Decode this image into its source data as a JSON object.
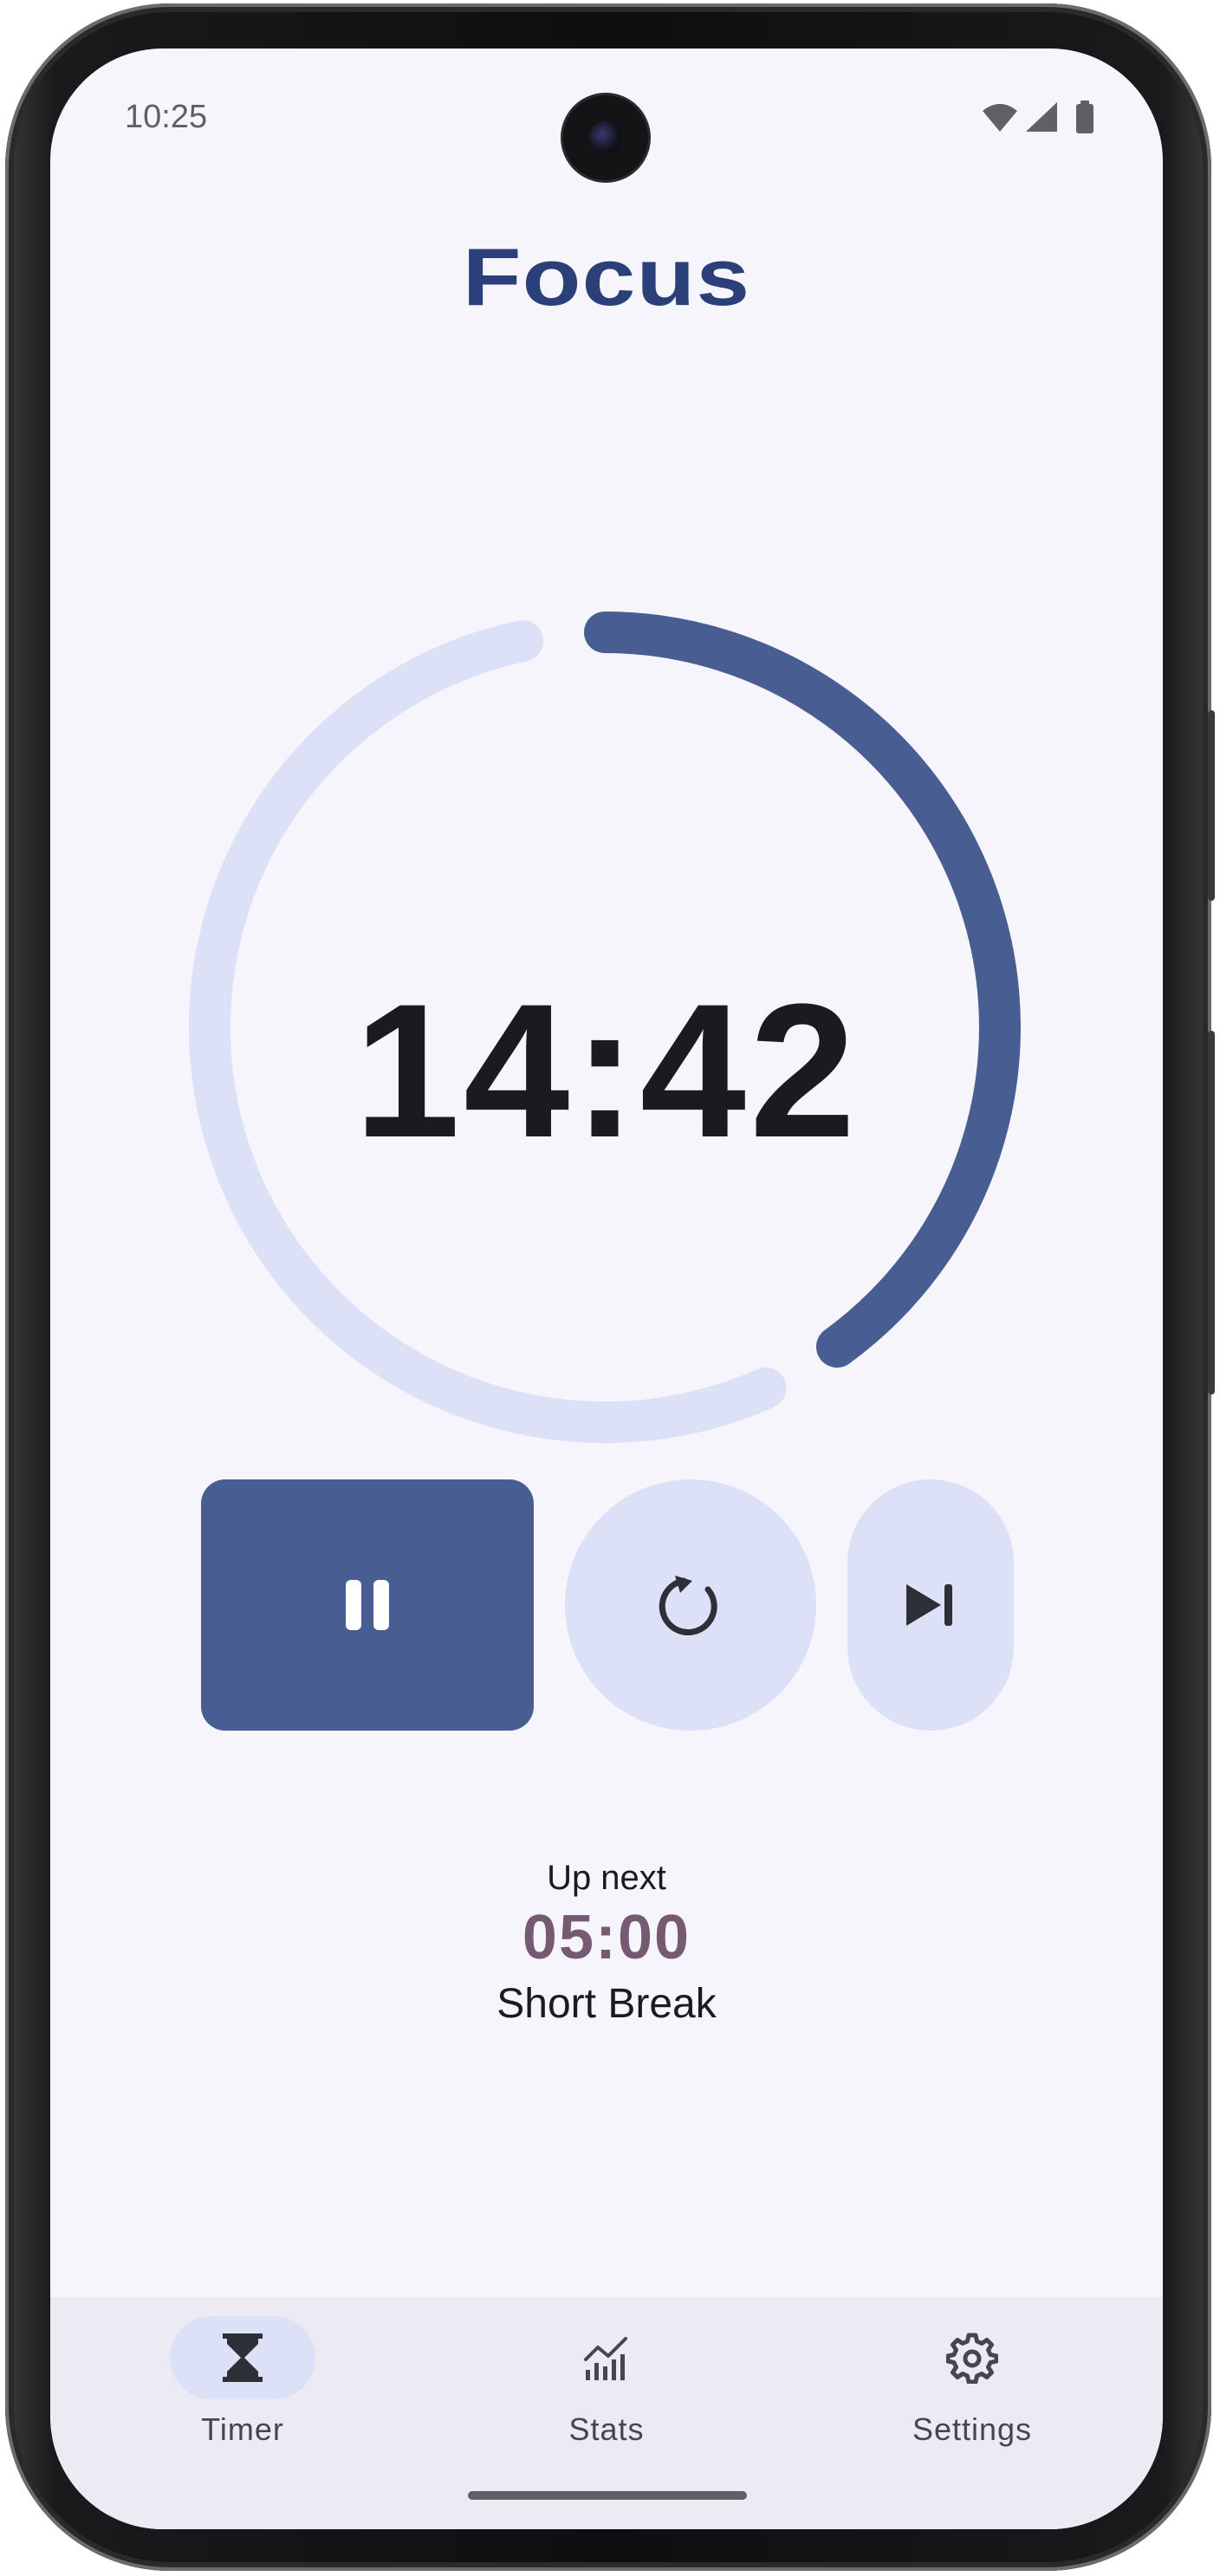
{
  "status_bar": {
    "time": "10:25"
  },
  "header": {
    "title": "Focus"
  },
  "timer": {
    "display": "14:42",
    "progress_fraction": 0.6
  },
  "controls": {
    "pause": {
      "icon": "pause-icon"
    },
    "reset": {
      "icon": "reset-icon"
    },
    "skip": {
      "icon": "skip-next-icon"
    }
  },
  "up_next": {
    "label": "Up next",
    "time": "05:00",
    "name": "Short Break"
  },
  "nav": {
    "items": [
      {
        "label": "Timer",
        "icon": "hourglass-icon",
        "active": true
      },
      {
        "label": "Stats",
        "icon": "stats-icon",
        "active": false
      },
      {
        "label": "Settings",
        "icon": "gear-icon",
        "active": false
      }
    ]
  },
  "colors": {
    "accent": "#485d92",
    "title": "#2b3f78",
    "track": "#dde1f8",
    "up_next_time": "#755a72",
    "background": "#f7f5fc"
  }
}
